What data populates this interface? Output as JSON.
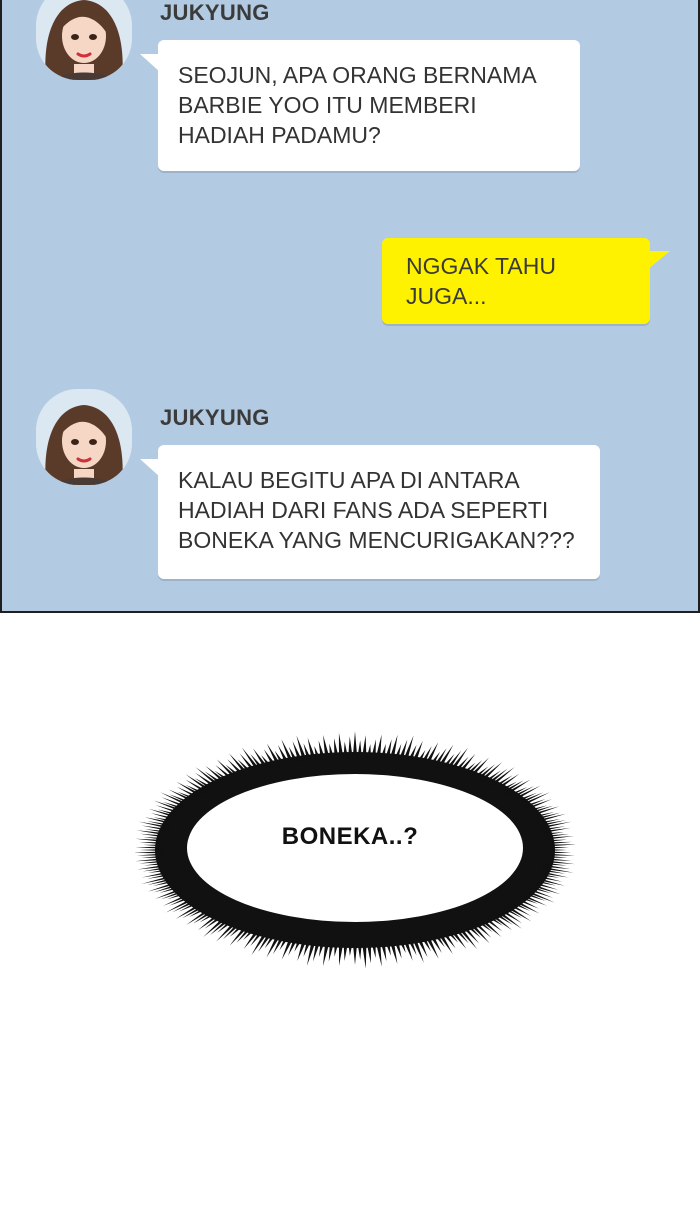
{
  "messages": [
    {
      "sender": "JUKYUNG",
      "lines": [
        "SEOJUN, APA ORANG BERNAMA",
        "BARBIE YOO ITU MEMBERI",
        "HADIAH PADAMU?"
      ]
    },
    {
      "sender": "",
      "lines": [
        "NGGAK TAHU",
        "JUGA..."
      ]
    },
    {
      "sender": "JUKYUNG",
      "lines": [
        "KALAU BEGITU APA DI ANTARA",
        "HADIAH DARI FANS ADA SEPERTI",
        "BONEKA YANG MENCURIGAKAN???"
      ]
    }
  ],
  "thought": {
    "text": "BONEKA..?"
  },
  "colors": {
    "chat_background": "#b3cbe2",
    "outgoing_bubble": "#fff200",
    "incoming_bubble": "#ffffff"
  },
  "icons": {
    "avatar": "girl-portrait-avatar"
  }
}
